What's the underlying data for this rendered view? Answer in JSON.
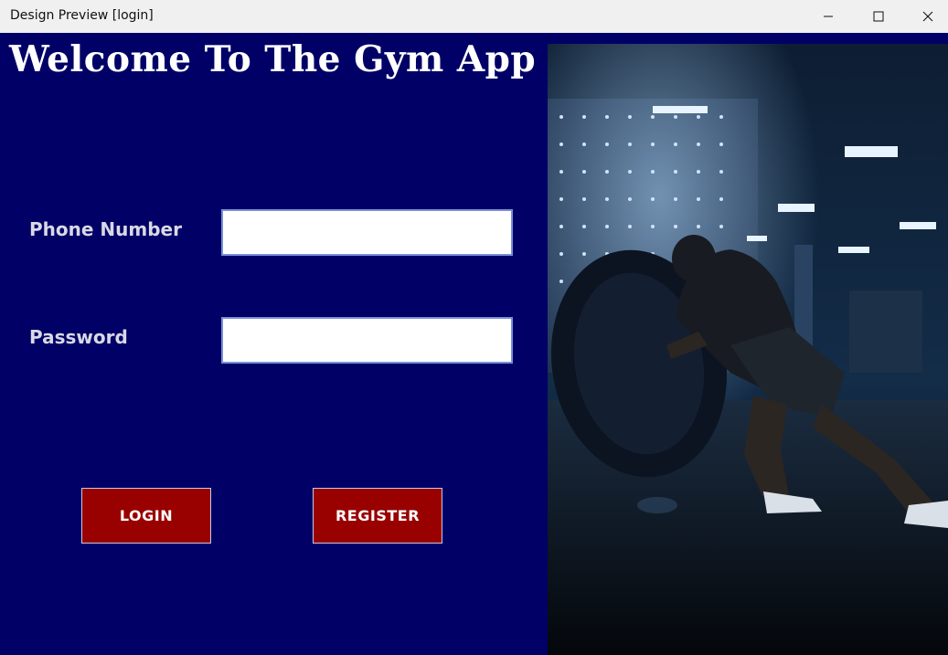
{
  "window": {
    "title": "Design Preview [login]"
  },
  "main": {
    "heading": "Welcome To The Gym App",
    "phone_label": "Phone Number",
    "phone_value": "",
    "password_label": "Password",
    "password_value": "",
    "login_label": "LOGIN",
    "register_label": "REGISTER"
  },
  "colors": {
    "background": "#000066",
    "button": "#990000",
    "text": "#ffffff"
  }
}
